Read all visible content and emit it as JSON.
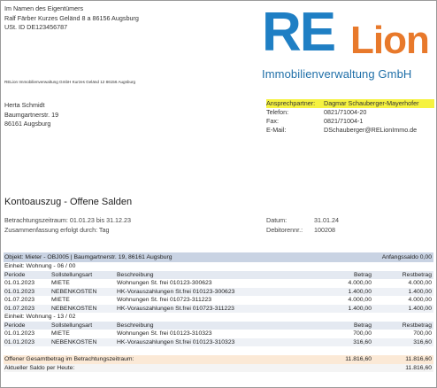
{
  "owner": {
    "line1": "Im Namen des Eigentümers",
    "line2": "Ralf Färber Kurzes Geländ 8 a 86156 Augsburg",
    "line3": "USt. ID DE123456787"
  },
  "logo": {
    "re": "RE",
    "lion": "Lion",
    "subtitle": "Immobilienverwaltung GmbH"
  },
  "sender_line": "RELion Immobilienverwaltung GmbH Kurzes Geländ 12 86156 Augsburg",
  "recipient": {
    "name": "Herta Schmidt",
    "street": "Baumgartnerstr. 19",
    "city": "86161 Augsburg"
  },
  "contact": {
    "person_label": "Ansprechpartner:",
    "person_value": "Dagmar Schauberger-Mayerhofer",
    "phone_label": "Telefon:",
    "phone_value": "0821/71004-20",
    "fax_label": "Fax:",
    "fax_value": "0821/71004-1",
    "email_label": "E-Mail:",
    "email_value": "DSchauberger@RELionImmo.de"
  },
  "title": "Kontoauszug - Offene Salden",
  "info": {
    "period": "Betrachtungszeitraum: 01.01.23 bis 31.12.23",
    "summary": "Zusammenfassung erfolgt durch: Tag",
    "date_label": "Datum:",
    "date_value": "31.01.24",
    "debtor_label": "Debitorennr.:",
    "debtor_value": "100208"
  },
  "table": {
    "object": "Objekt: Mieter - OBJ005 | Baumgartnerstr. 19, 86161 Augsburg",
    "opening": "Anfangssaldo 0,00",
    "headers": {
      "period": "Periode",
      "type": "Sollstellungsart",
      "desc": "Beschreibung",
      "amount": "Betrag",
      "rest": "Restbetrag"
    },
    "unit1": "Einheit: Wohnung - 06 / 00",
    "unit1_rows": [
      {
        "period": "01.01.2023",
        "type": "MIETE",
        "desc": "Wohnungen St. frei 010123-300623",
        "amount": "4.000,00",
        "rest": "4.000,00"
      },
      {
        "period": "01.01.2023",
        "type": "NEBENKOSTEN",
        "desc": "HK-Vorauszahlungen St.frei 010123-300623",
        "amount": "1.400,00",
        "rest": "1.400,00"
      },
      {
        "period": "01.07.2023",
        "type": "MIETE",
        "desc": "Wohnungen St. frei 010723-311223",
        "amount": "4.000,00",
        "rest": "4.000,00"
      },
      {
        "period": "01.07.2023",
        "type": "NEBENKOSTEN",
        "desc": "HK-Vorauszahlungen St.frei 010723-311223",
        "amount": "1.400,00",
        "rest": "1.400,00"
      }
    ],
    "unit2": "Einheit: Wohnung - 13 / 02",
    "unit2_rows": [
      {
        "period": "01.01.2023",
        "type": "MIETE",
        "desc": "Wohnungen St. frei 010123-310323",
        "amount": "700,00",
        "rest": "700,00"
      },
      {
        "period": "01.01.2023",
        "type": "NEBENKOSTEN",
        "desc": "HK-Vorauszahlungen St.frei 010123-310323",
        "amount": "316,60",
        "rest": "316,60"
      }
    ],
    "total_label": "Offener Gesamtbetrag im Betrachtungszeitraum:",
    "total_amount": "11.816,60",
    "total_rest": "11.816,60",
    "current_label": "Aktueller Saldo per Heute:",
    "current_rest": "11.816,60"
  }
}
